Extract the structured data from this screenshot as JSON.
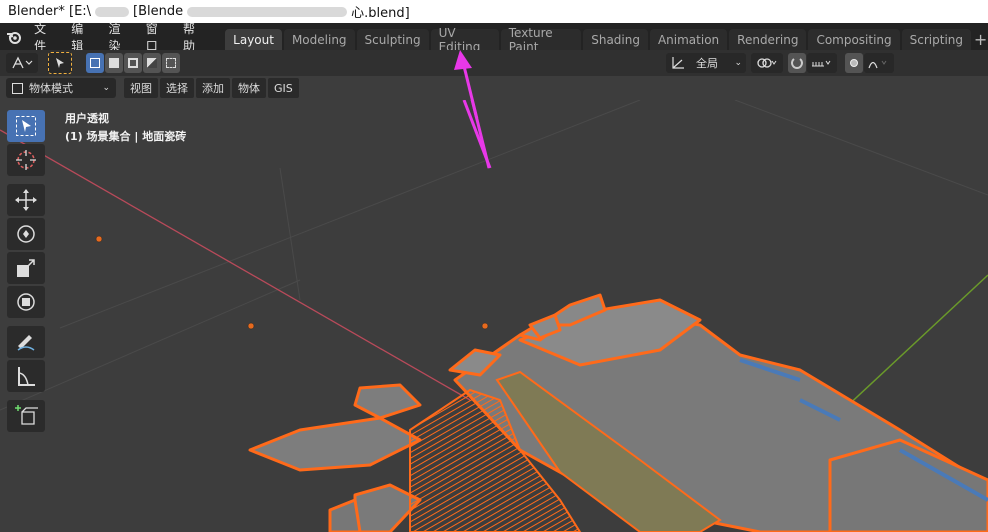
{
  "os_title": {
    "left": "Blender* [E:\\",
    "middle": "[Blende",
    "right": "心.blend]"
  },
  "menu": [
    "文件",
    "编辑",
    "渲染",
    "窗口",
    "帮助"
  ],
  "tabs": [
    "Layout",
    "Modeling",
    "Sculpting",
    "UV Editing",
    "Texture Paint",
    "Shading",
    "Animation",
    "Rendering",
    "Compositing",
    "Scripting"
  ],
  "active_tab": "Layout",
  "tool_settings": {
    "orientation": "全局"
  },
  "viewport_header": {
    "mode": "物体模式",
    "menus": [
      "视图",
      "选择",
      "添加",
      "物体",
      "GIS"
    ]
  },
  "overlay": {
    "view_name": "用户透视",
    "collection": "(1) 场景集合 | 地面瓷砖"
  },
  "colors": {
    "accent": "#4772b3",
    "selection": "#ff6a1a",
    "annotation_arrow": "#e838e8"
  }
}
